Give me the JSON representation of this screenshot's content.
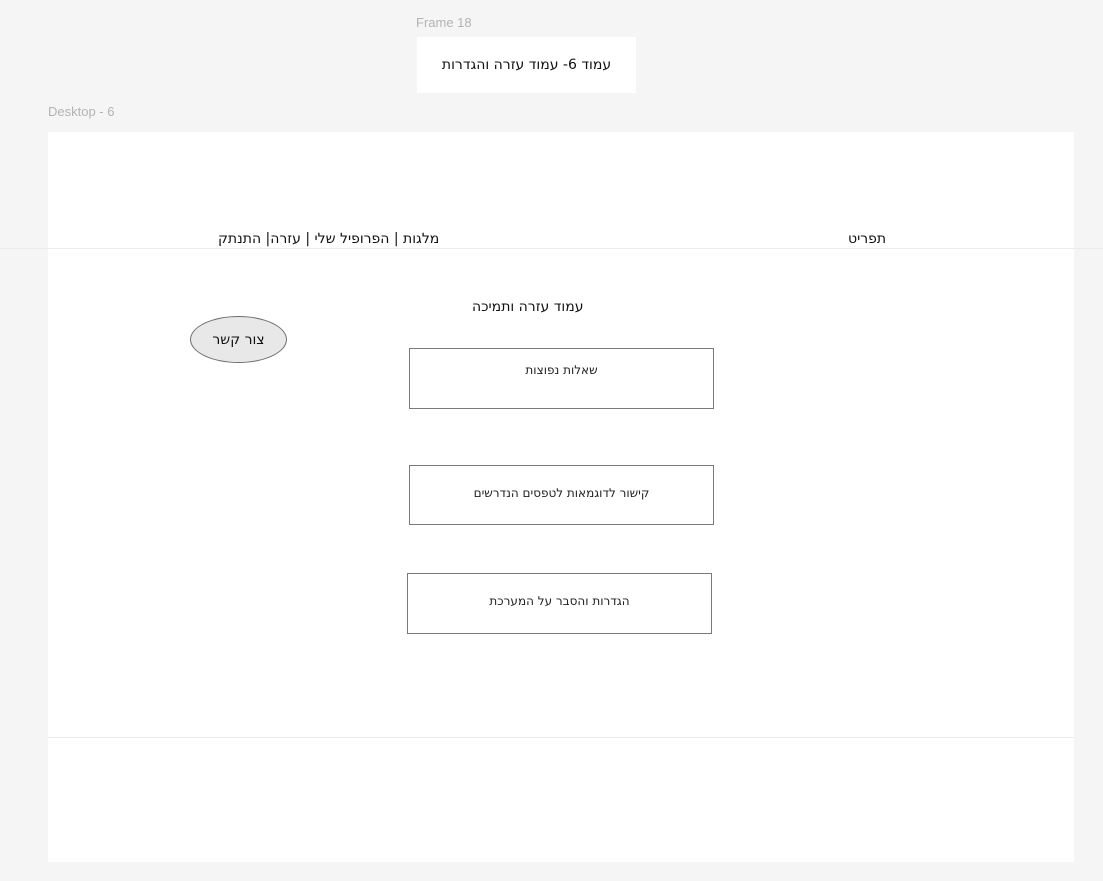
{
  "frame": {
    "label": "Frame 18",
    "title": "עמוד 6- עמוד עזרה והגדרות"
  },
  "desktop": {
    "label": "Desktop - 6"
  },
  "nav": {
    "menu_label": "תפריט",
    "links_text": "מלגות | הפרופיל שלי | עזרה| התנתק"
  },
  "main": {
    "heading": "עמוד עזרה ותמיכה",
    "contact_button": "צור קשר",
    "buttons": [
      {
        "label": "שאלות נפוצות"
      },
      {
        "label": "קישור לדוגמאות לטפסים הנדרשים"
      },
      {
        "label": "הגדרות והסבר על המערכת"
      }
    ]
  }
}
